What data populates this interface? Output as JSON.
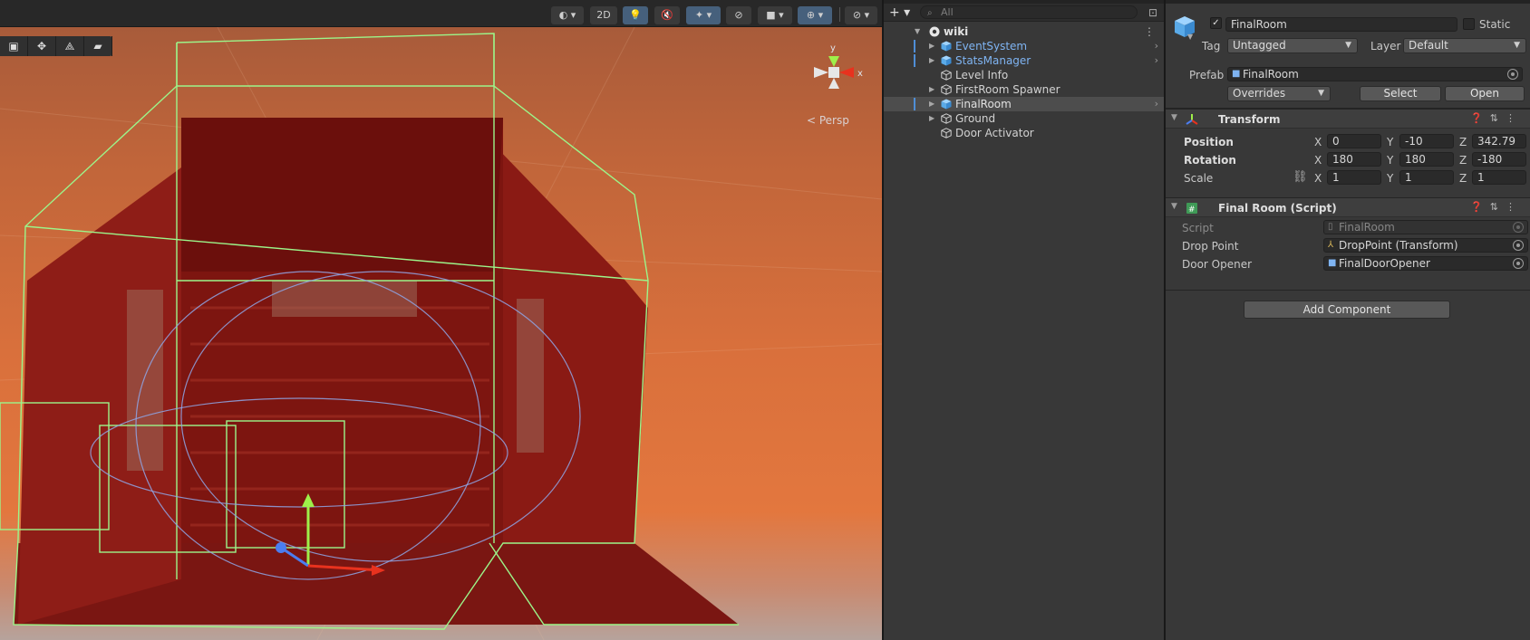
{
  "scene_view": {
    "toolbar": {
      "toggle_2d": "2D"
    },
    "camera_label": "< Persp",
    "gizmo_axes": {
      "x": "x",
      "y": "y"
    }
  },
  "hierarchy": {
    "search_placeholder": "All",
    "scene_name": "wiki",
    "items": [
      {
        "label": "EventSystem",
        "prefab": true,
        "foldout": true,
        "selected": false
      },
      {
        "label": "StatsManager",
        "prefab": true,
        "foldout": true,
        "selected": false
      },
      {
        "label": "Level Info",
        "prefab": false,
        "foldout": false,
        "selected": false
      },
      {
        "label": "FirstRoom Spawner",
        "prefab": false,
        "foldout": true,
        "selected": false
      },
      {
        "label": "FinalRoom",
        "prefab": true,
        "foldout": true,
        "selected": true
      },
      {
        "label": "Ground",
        "prefab": false,
        "foldout": true,
        "selected": false
      },
      {
        "label": "Door Activator",
        "prefab": false,
        "foldout": false,
        "selected": false
      }
    ]
  },
  "inspector": {
    "object_name": "FinalRoom",
    "static_label": "Static",
    "tag_label": "Tag",
    "tag_value": "Untagged",
    "layer_label": "Layer",
    "layer_value": "Default",
    "prefab_label": "Prefab",
    "prefab_value": "FinalRoom",
    "overrides_label": "Overrides",
    "select_label": "Select",
    "open_label": "Open",
    "transform": {
      "title": "Transform",
      "position_label": "Position",
      "rotation_label": "Rotation",
      "scale_label": "Scale",
      "position": {
        "x": "0",
        "y": "-10",
        "z": "342.79"
      },
      "rotation": {
        "x": "180",
        "y": "180",
        "z": "-180"
      },
      "scale": {
        "x": "1",
        "y": "1",
        "z": "1"
      },
      "axis_x": "X",
      "axis_y": "Y",
      "axis_z": "Z"
    },
    "script_component": {
      "title": "Final Room (Script)",
      "script_label": "Script",
      "script_value": "FinalRoom",
      "drop_point_label": "Drop Point",
      "drop_point_value": "DropPoint (Transform)",
      "door_opener_label": "Door Opener",
      "door_opener_value": "FinalDoorOpener"
    },
    "add_component_label": "Add Component"
  },
  "colors": {
    "prefab_blue": "#7fb4f2",
    "room_red": "#8a1a14",
    "wire_green": "#8ef07a"
  }
}
